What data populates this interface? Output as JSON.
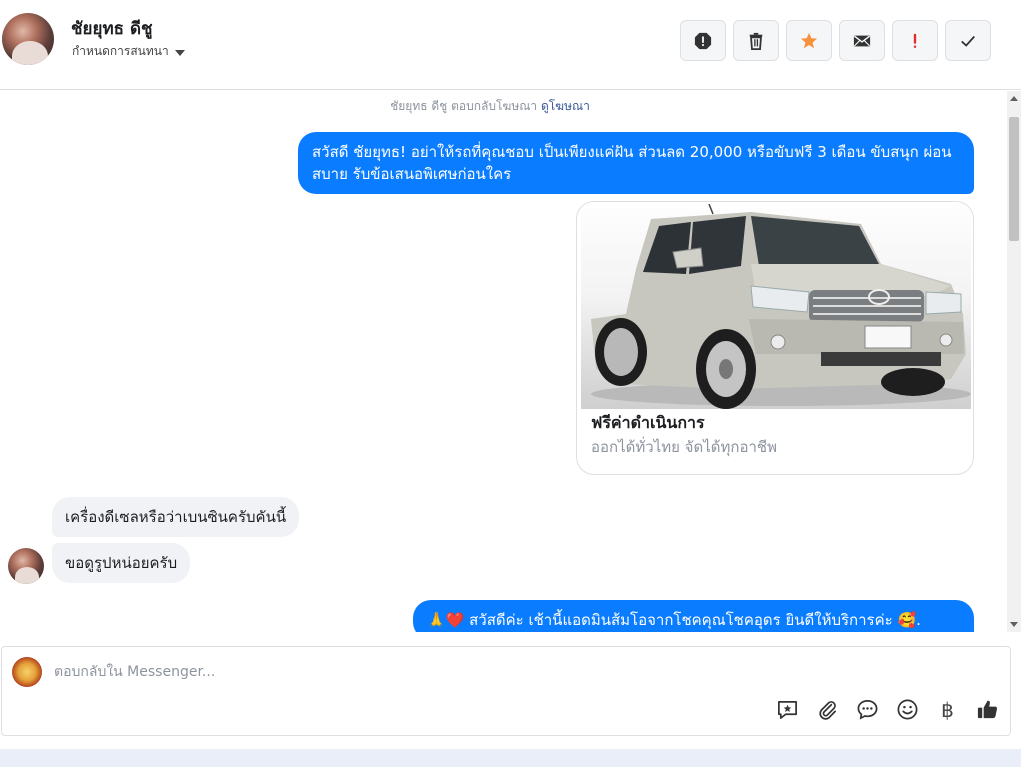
{
  "header": {
    "contact_name": "ชัยยุทธ ดีชู",
    "assign_label": "กำหนดการสนทนา"
  },
  "toolbar": {
    "buttons": [
      {
        "name": "spam",
        "icon": "alert-octagon-icon"
      },
      {
        "name": "delete",
        "icon": "trash-icon"
      },
      {
        "name": "star",
        "icon": "star-icon",
        "color": "#f7923b"
      },
      {
        "name": "mark-unread",
        "icon": "envelope-icon"
      },
      {
        "name": "follow-up",
        "icon": "exclamation-icon",
        "color": "#e02d2d"
      },
      {
        "name": "done",
        "icon": "check-icon"
      }
    ]
  },
  "conversation": {
    "ad_note_prefix": "ชัยยุทธ ดีชู ตอบกลับโฆษณา",
    "ad_note_link": "ดูโฆษณา",
    "messages": [
      {
        "direction": "out",
        "text": "สวัสดี ชัยยุทธ! อย่าให้รถที่คุณชอบ เป็นเพียงแค่ฝัน ส่วนลด 20,000 หรือขับฟรี 3 เดือน ขับสนุก ผ่อนสบาย รับข้อเสนอพิเศษก่อนใคร"
      },
      {
        "direction": "in",
        "text": "เครื่องดีเซลหรือว่าเบนซินครับคันนี้"
      },
      {
        "direction": "in",
        "text": "ขอดูรูปหน่อยครับ"
      },
      {
        "direction": "out",
        "text": "🙏❤️ สวัสดีค่ะ เช้านี้แอดมินส้มโอจากโชคคุณโชคอุดร ยินดีให้บริการค่ะ 🥰."
      }
    ],
    "card": {
      "title": "ฟรีค่าดำเนินการ",
      "subtitle": "ออกได้ทั่วไทย จัดได้ทุกอาชีพ",
      "image": "silver-toyota-pickup-truck"
    }
  },
  "composer": {
    "placeholder": "ตอบกลับใน Messenger...",
    "icons": [
      "saved-reply-icon",
      "attachment-icon",
      "quick-reply-icon",
      "emoji-icon",
      "baht-icon",
      "thumbs-up-icon"
    ],
    "baht_symbol": "฿"
  },
  "colors": {
    "outgoing_bubble": "#0a7cff",
    "incoming_bubble": "#f0f2f5",
    "link": "#385898"
  }
}
